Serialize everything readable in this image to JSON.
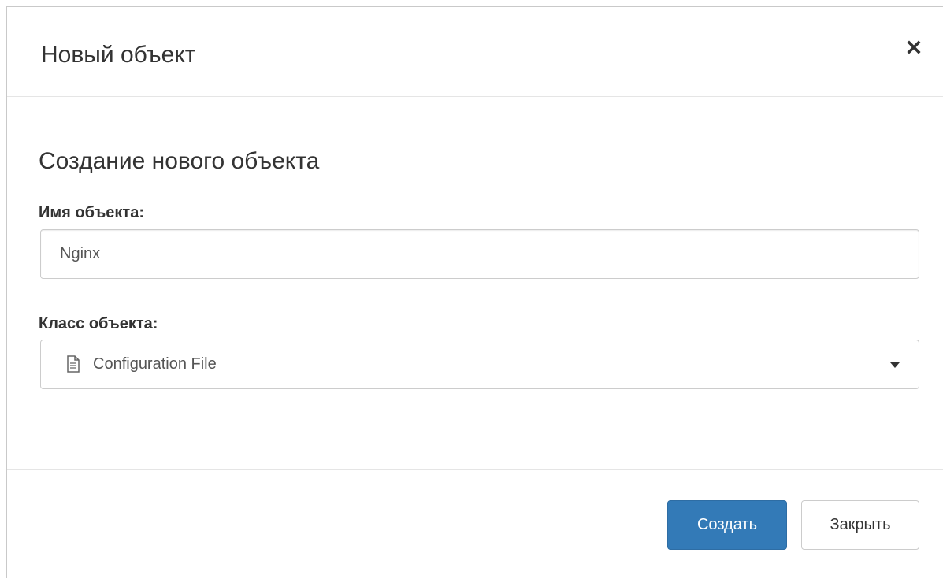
{
  "modal": {
    "title": "Новый объект",
    "close_icon": "close-icon"
  },
  "body": {
    "section_title": "Создание нового объекта",
    "name_field": {
      "label": "Имя объекта:",
      "value": "Nginx"
    },
    "class_field": {
      "label": "Класс объекта:",
      "selected": "Configuration File",
      "icon": "file-icon"
    }
  },
  "footer": {
    "create_label": "Создать",
    "close_label": "Закрыть"
  },
  "colors": {
    "primary": "#337ab7",
    "border": "#cccccc",
    "text": "#333333"
  }
}
